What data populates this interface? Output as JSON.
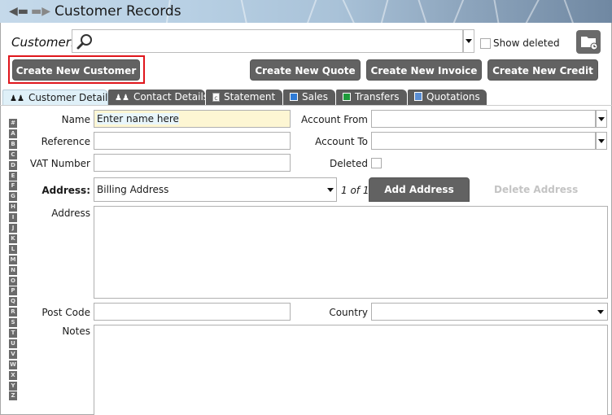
{
  "window": {
    "title": "Customer Records",
    "back_icon": "arrow-left-icon",
    "forward_icon": "arrow-right-icon"
  },
  "customer_search": {
    "label": "Customer:",
    "value": "",
    "search_icon": "search-icon",
    "show_deleted_label": "Show deleted",
    "show_deleted_checked": false,
    "folder_icon": "folder-clock-icon"
  },
  "toolbar": {
    "create_customer": "Create New Customer",
    "create_quote": "Create New Quote",
    "create_invoice": "Create New Invoice",
    "create_credit": "Create New Credit",
    "highlight_color": "#e0161c",
    "button_color": "#626262"
  },
  "tabs": [
    {
      "label": "Customer Details",
      "icon": "people-icon",
      "active": true
    },
    {
      "label": "Contact Details",
      "icon": "people-icon",
      "active": false
    },
    {
      "label": "Statement",
      "icon": "document-icon",
      "active": false
    },
    {
      "label": "Sales",
      "icon": "blue-square-icon",
      "active": false
    },
    {
      "label": "Transfers",
      "icon": "green-square-icon",
      "active": false
    },
    {
      "label": "Quotations",
      "icon": "quote-doc-icon",
      "active": false
    }
  ],
  "alphabet": [
    "#",
    "A",
    "B",
    "C",
    "D",
    "E",
    "F",
    "G",
    "H",
    "I",
    "J",
    "K",
    "L",
    "M",
    "N",
    "O",
    "P",
    "Q",
    "R",
    "S",
    "T",
    "U",
    "V",
    "W",
    "X",
    "Y",
    "Z"
  ],
  "form": {
    "name_label": "Name",
    "name_value": "Enter name here",
    "reference_label": "Reference",
    "reference_value": "",
    "vat_label": "VAT Number",
    "vat_value": "",
    "account_from_label": "Account From",
    "account_from_value": "",
    "account_to_label": "Account To",
    "account_to_value": "",
    "deleted_label": "Deleted",
    "deleted_checked": false,
    "address_selector_label": "Address:",
    "address_selector_value": "Billing Address",
    "address_count": "1 of 1",
    "add_address": "Add Address",
    "delete_address": "Delete Address",
    "address_label": "Address",
    "address_value": "",
    "post_code_label": "Post Code",
    "post_code_value": "",
    "country_label": "Country",
    "country_value": "",
    "notes_label": "Notes",
    "notes_value": ""
  }
}
